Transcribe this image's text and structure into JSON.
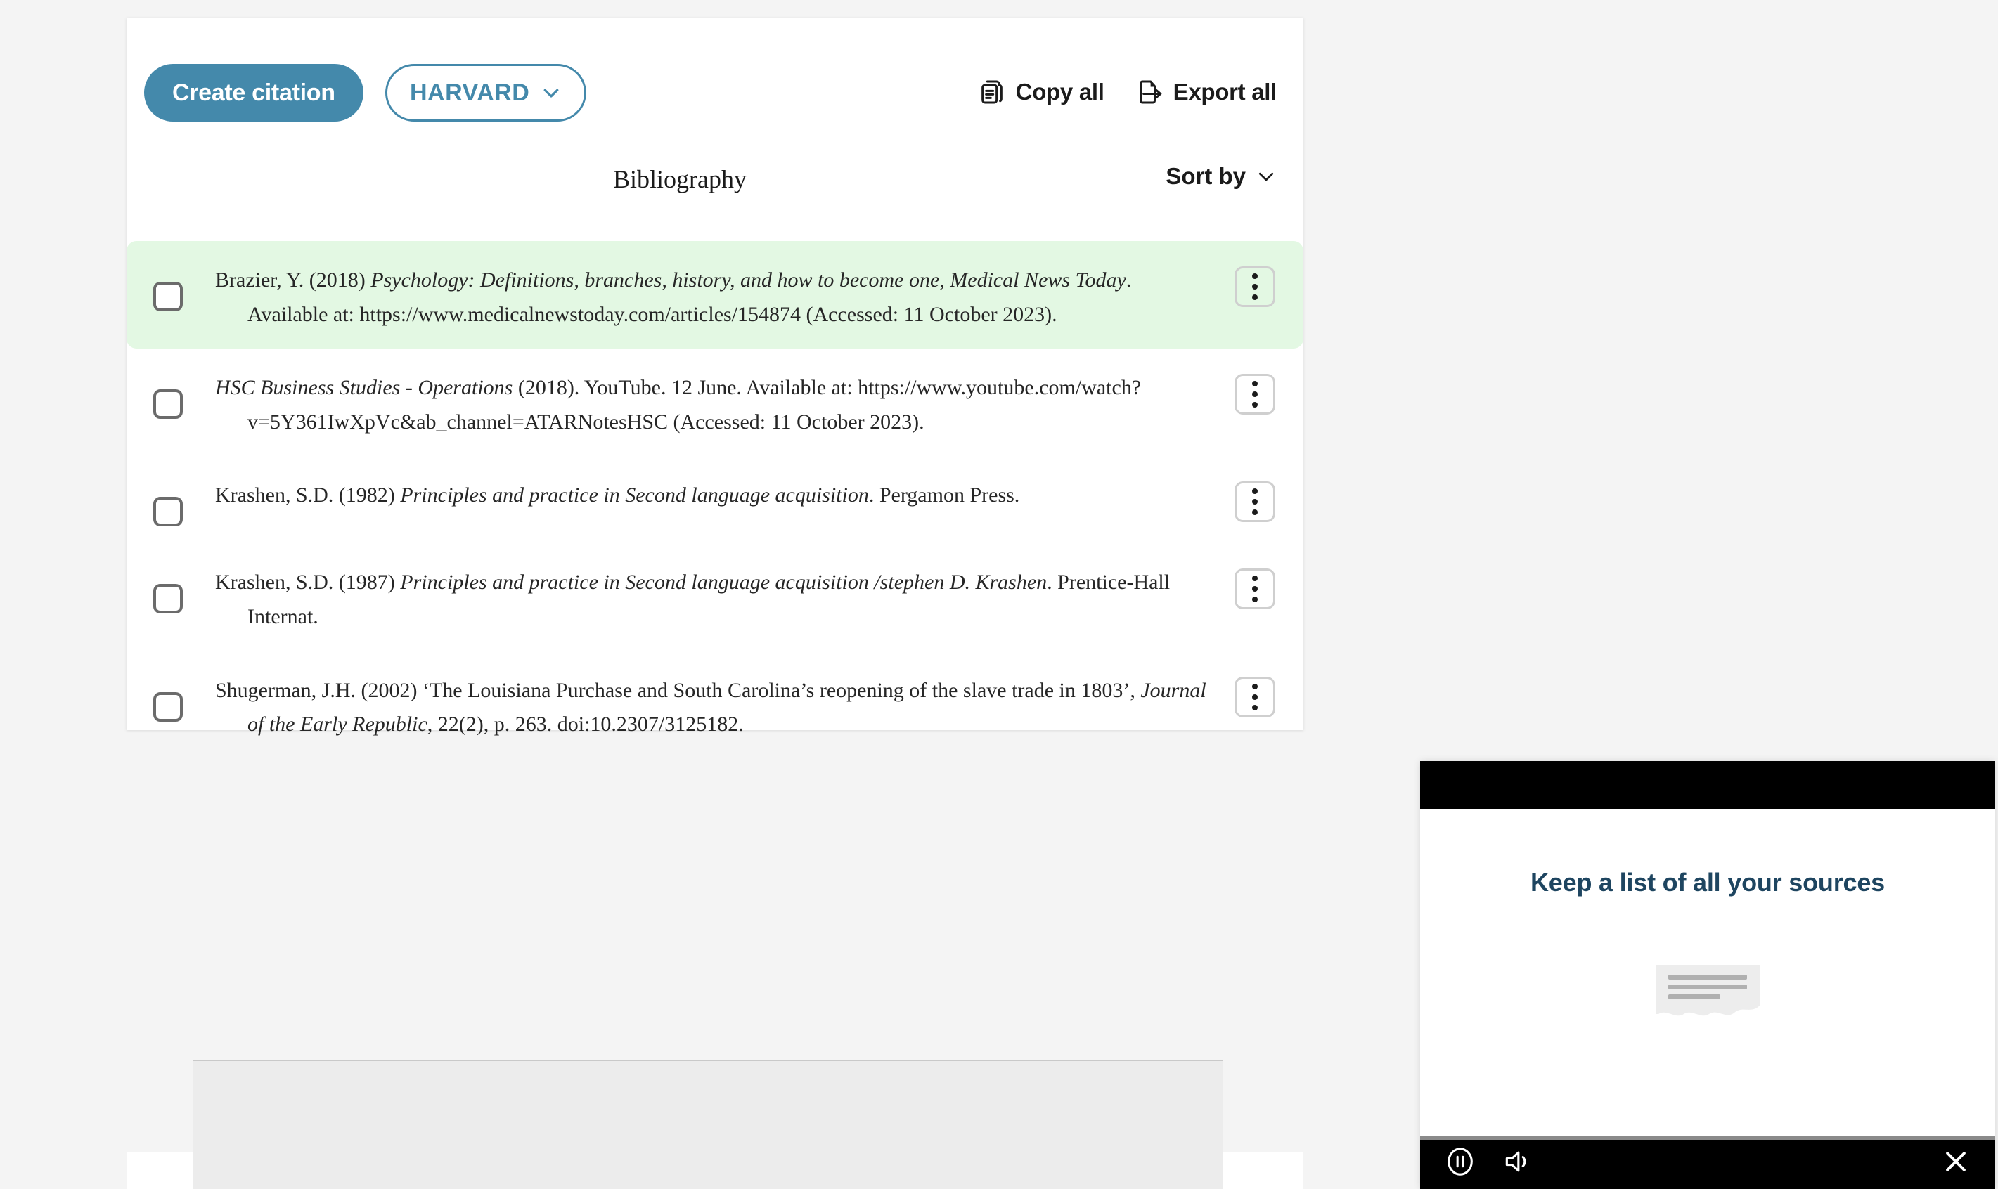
{
  "toolbar": {
    "create_citation_label": "Create citation",
    "style_label": "HARVARD",
    "copy_all_label": "Copy all",
    "export_all_label": "Export all"
  },
  "list_header": {
    "title": "Bibliography",
    "sort_label": "Sort by"
  },
  "citations": [
    {
      "author_year": "Brazier, Y. (2018) ",
      "title_italic": "Psychology: Definitions, branches, history, and how to become one, Medical News Today",
      "rest": ". Available at: https://www.medicalnewstoday.com/articles/154874 (Accessed: 11 October 2023).",
      "highlighted": true
    },
    {
      "author_year": "",
      "title_italic": "HSC Business Studies - Operations",
      "rest": " (2018). YouTube. 12 June. Available at: https://www.youtube.com/watch?v=5Y361IwXpVc&ab_channel=ATARNotesHSC (Accessed: 11 October 2023).",
      "highlighted": false
    },
    {
      "author_year": "Krashen, S.D. (1982) ",
      "title_italic": "Principles and practice in Second language acquisition",
      "rest": ". Pergamon Press.",
      "highlighted": false
    },
    {
      "author_year": "Krashen, S.D. (1987) ",
      "title_italic": "Principles and practice in Second language acquisition /stephen D. Krashen",
      "rest": ". Prentice-Hall Internat.",
      "highlighted": false
    },
    {
      "author_year": "Shugerman, J.H. (2002) ‘The Louisiana Purchase and South Carolina’s reopening of the slave trade in 1803’, ",
      "title_italic": "Journal of the Early Republic",
      "rest": ", 22(2), p. 263. doi:10.2307/3125182.",
      "highlighted": false
    }
  ],
  "video": {
    "headline": "Keep a list of all your sources"
  },
  "colors": {
    "accent_blue": "#4489ab",
    "highlight_green": "#e3f8e3",
    "headline_navy": "#1e4560",
    "page_bg": "#f4f4f4"
  }
}
